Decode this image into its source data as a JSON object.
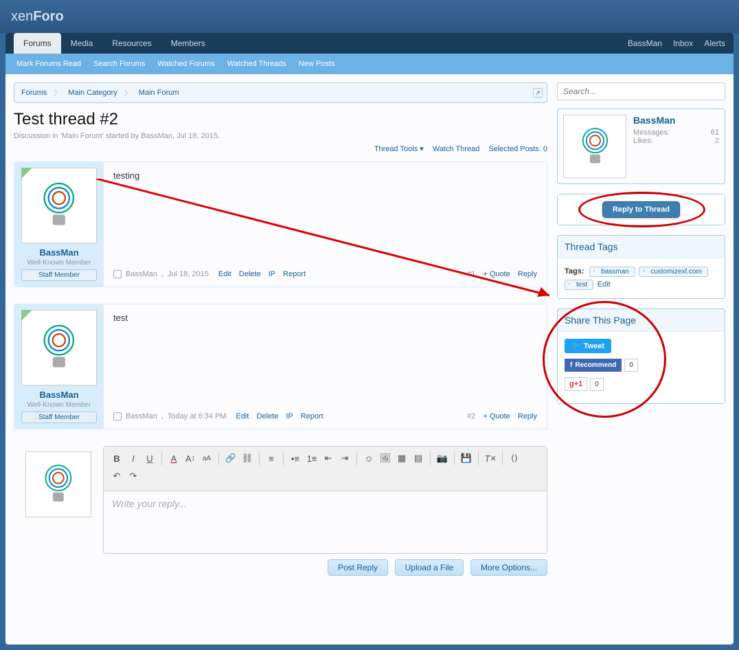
{
  "logo": {
    "prefix": "xen",
    "suffix": "Foro"
  },
  "nav": {
    "tabs": [
      "Forums",
      "Media",
      "Resources",
      "Members"
    ],
    "right": {
      "user": "BassMan",
      "inbox": "Inbox",
      "alerts": "Alerts"
    }
  },
  "subnav": [
    "Mark Forums Read",
    "Search Forums",
    "Watched Forums",
    "Watched Threads",
    "New Posts"
  ],
  "breadcrumb": [
    "Forums",
    "Main Category",
    "Main Forum"
  ],
  "thread": {
    "title": "Test thread #2",
    "desc_prefix": "Discussion in '",
    "desc_forum": "Main Forum",
    "desc_mid": "' started by ",
    "desc_user": "BassMan",
    "desc_date": "Jul 18, 2015",
    "tools": {
      "tools": "Thread Tools",
      "watch": "Watch Thread",
      "selected": "Selected Posts: 0"
    }
  },
  "posts": [
    {
      "user": "BassMan",
      "title": "Well-Known Member",
      "banner": "Staff Member",
      "content": "testing",
      "date": "Jul 18, 2015",
      "num": "#1",
      "actions": {
        "edit": "Edit",
        "delete": "Delete",
        "ip": "IP",
        "report": "Report",
        "quote": "+ Quote",
        "reply": "Reply"
      }
    },
    {
      "user": "BassMan",
      "title": "Well-Known Member",
      "banner": "Staff Member",
      "content": "test",
      "date": "Today at 6:34 PM",
      "num": "#2",
      "actions": {
        "edit": "Edit",
        "delete": "Delete",
        "ip": "IP",
        "report": "Report",
        "quote": "+ Quote",
        "reply": "Reply"
      }
    }
  ],
  "editor": {
    "placeholder": "Write your reply...",
    "buttons": {
      "post": "Post Reply",
      "upload": "Upload a File",
      "more": "More Options..."
    }
  },
  "search": {
    "placeholder": "Search..."
  },
  "visitor": {
    "name": "BassMan",
    "messages_label": "Messages:",
    "messages": "61",
    "likes_label": "Likes:",
    "likes": "2"
  },
  "reply_btn": "Reply to Thread",
  "tags_block": {
    "heading": "Thread Tags",
    "label": "Tags:",
    "tags": [
      "bassman",
      "customizexf.com",
      "test"
    ],
    "edit": "Edit"
  },
  "share_block": {
    "heading": "Share This Page",
    "tweet": "Tweet",
    "recommend": "Recommend",
    "fb_count": "0",
    "gplus": "+1",
    "gplus_count": "0"
  }
}
